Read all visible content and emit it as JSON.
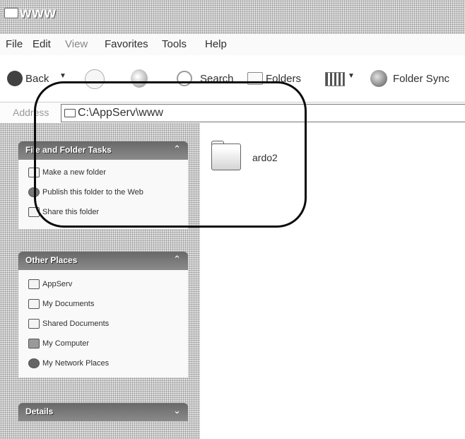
{
  "window": {
    "title": "www"
  },
  "menu": [
    "File",
    "Edit",
    "View",
    "Favorites",
    "Tools",
    "Help"
  ],
  "toolbar": {
    "back_label": "Back",
    "search_label": "Search",
    "folders_label": "Folders",
    "folder_sync_label": "Folder Sync"
  },
  "address": {
    "label": "Address",
    "path": "C:\\AppServ\\www"
  },
  "tasks_panel": {
    "title": "File and Folder Tasks",
    "items": [
      "Make a new folder",
      "Publish this folder to the Web",
      "Share this folder"
    ]
  },
  "other_places": {
    "title": "Other Places",
    "items": [
      "AppServ",
      "My Documents",
      "Shared Documents",
      "My Computer",
      "My Network Places"
    ]
  },
  "details": {
    "title": "Details"
  },
  "main": {
    "items": [
      {
        "name": "ardo2",
        "icon": "folder-icon"
      }
    ]
  }
}
